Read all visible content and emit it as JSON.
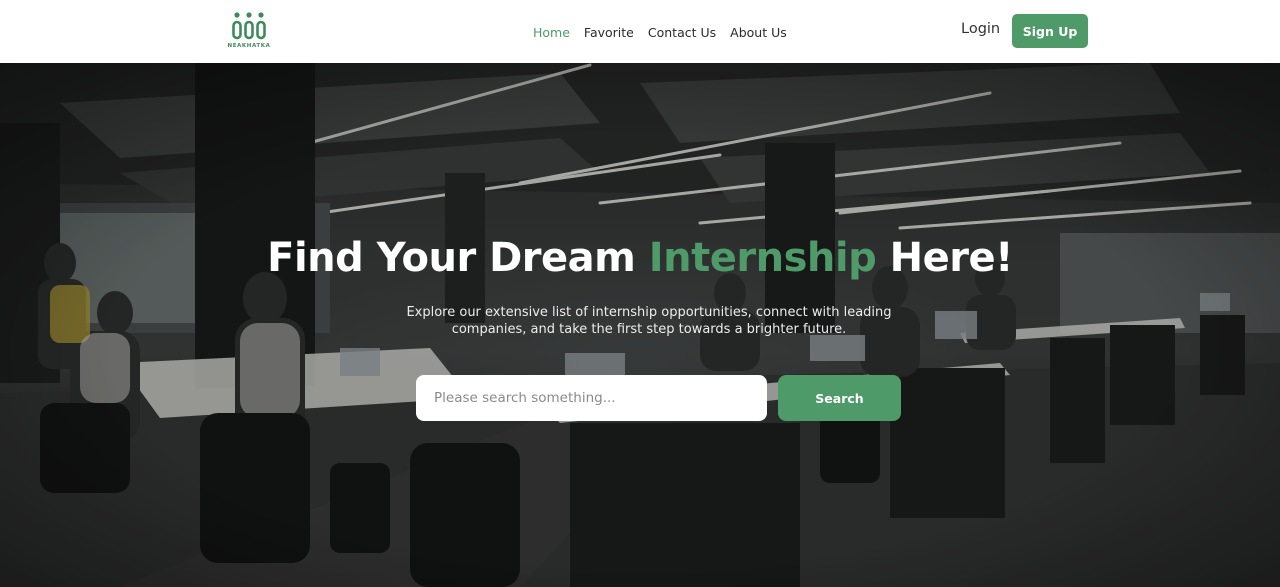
{
  "brand": {
    "logo_icon": "three-people-logo-icon",
    "name": "NEAKHATKA",
    "color": "#4f9a69"
  },
  "nav": {
    "items": [
      {
        "label": "Home",
        "active": true
      },
      {
        "label": "Favorite",
        "active": false
      },
      {
        "label": "Contact Us",
        "active": false
      },
      {
        "label": "About Us",
        "active": false
      }
    ],
    "active_color": "#4f9a69"
  },
  "auth": {
    "login_label": "Login",
    "signup_label": "Sign Up"
  },
  "hero": {
    "title_part1": "Find Your Dream ",
    "title_accent": "Internship",
    "title_part2": " Here!",
    "subtitle": "Explore our extensive list of internship opportunities, connect with leading companies, and take the first step towards a brighter future.",
    "background": "office-workspace-photo"
  },
  "search": {
    "placeholder": "Please search something...",
    "value": "",
    "button_label": "Search"
  }
}
